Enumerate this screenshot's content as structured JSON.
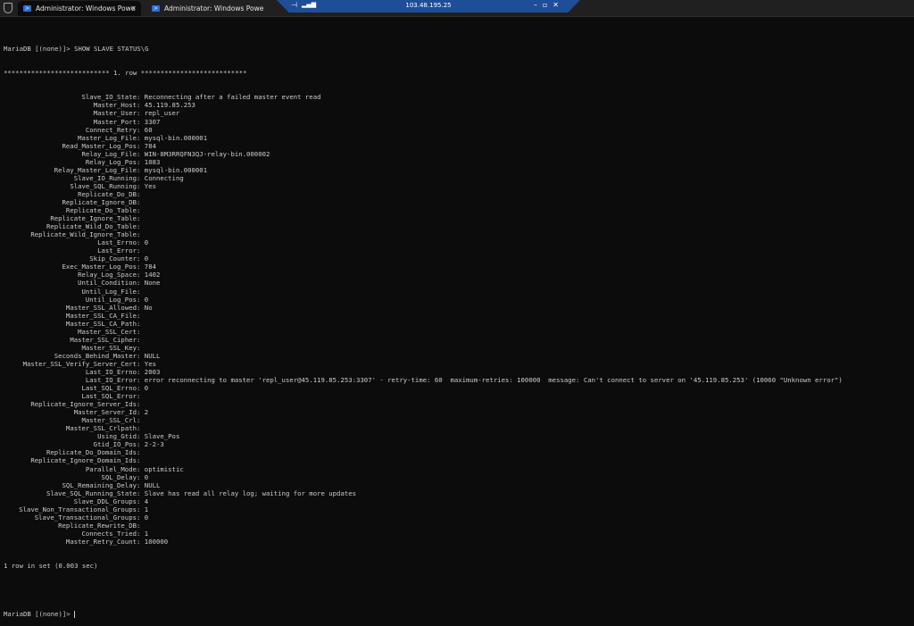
{
  "tabs": [
    {
      "title": "Administrator: Windows Powe",
      "active": true
    },
    {
      "title": "Administrator: Windows Powe",
      "active": false
    }
  ],
  "remote_bar": {
    "ip": "103.48.195.25"
  },
  "console": {
    "command": "MariaDB [(none)]> SHOW SLAVE STATUS\\G",
    "row_header": "*************************** 1. row ***************************",
    "fields": [
      {
        "k": "Slave_IO_State",
        "v": "Reconnecting after a failed master event read"
      },
      {
        "k": "Master_Host",
        "v": "45.119.85.253"
      },
      {
        "k": "Master_User",
        "v": "repl_user"
      },
      {
        "k": "Master_Port",
        "v": "3307"
      },
      {
        "k": "Connect_Retry",
        "v": "60"
      },
      {
        "k": "Master_Log_File",
        "v": "mysql-bin.000001"
      },
      {
        "k": "Read_Master_Log_Pos",
        "v": "784"
      },
      {
        "k": "Relay_Log_File",
        "v": "WIN-8M3RRQFN3QJ-relay-bin.000002"
      },
      {
        "k": "Relay_Log_Pos",
        "v": "1083"
      },
      {
        "k": "Relay_Master_Log_File",
        "v": "mysql-bin.000001"
      },
      {
        "k": "Slave_IO_Running",
        "v": "Connecting"
      },
      {
        "k": "Slave_SQL_Running",
        "v": "Yes"
      },
      {
        "k": "Replicate_Do_DB",
        "v": ""
      },
      {
        "k": "Replicate_Ignore_DB",
        "v": ""
      },
      {
        "k": "Replicate_Do_Table",
        "v": ""
      },
      {
        "k": "Replicate_Ignore_Table",
        "v": ""
      },
      {
        "k": "Replicate_Wild_Do_Table",
        "v": ""
      },
      {
        "k": "Replicate_Wild_Ignore_Table",
        "v": ""
      },
      {
        "k": "Last_Errno",
        "v": "0"
      },
      {
        "k": "Last_Error",
        "v": ""
      },
      {
        "k": "Skip_Counter",
        "v": "0"
      },
      {
        "k": "Exec_Master_Log_Pos",
        "v": "784"
      },
      {
        "k": "Relay_Log_Space",
        "v": "1402"
      },
      {
        "k": "Until_Condition",
        "v": "None"
      },
      {
        "k": "Until_Log_File",
        "v": ""
      },
      {
        "k": "Until_Log_Pos",
        "v": "0"
      },
      {
        "k": "Master_SSL_Allowed",
        "v": "No"
      },
      {
        "k": "Master_SSL_CA_File",
        "v": ""
      },
      {
        "k": "Master_SSL_CA_Path",
        "v": ""
      },
      {
        "k": "Master_SSL_Cert",
        "v": ""
      },
      {
        "k": "Master_SSL_Cipher",
        "v": ""
      },
      {
        "k": "Master_SSL_Key",
        "v": ""
      },
      {
        "k": "Seconds_Behind_Master",
        "v": "NULL"
      },
      {
        "k": "Master_SSL_Verify_Server_Cert",
        "v": "Yes"
      },
      {
        "k": "Last_IO_Errno",
        "v": "2003"
      },
      {
        "k": "Last_IO_Error",
        "v": "error reconnecting to master 'repl_user@45.119.85.253:3307' - retry-time: 60  maximum-retries: 100000  message: Can't connect to server on '45.119.85.253' (10060 \"Unknown error\")"
      },
      {
        "k": "Last_SQL_Errno",
        "v": "0"
      },
      {
        "k": "Last_SQL_Error",
        "v": ""
      },
      {
        "k": "Replicate_Ignore_Server_Ids",
        "v": ""
      },
      {
        "k": "Master_Server_Id",
        "v": "2"
      },
      {
        "k": "Master_SSL_Crl",
        "v": ""
      },
      {
        "k": "Master_SSL_Crlpath",
        "v": ""
      },
      {
        "k": "Using_Gtid",
        "v": "Slave_Pos"
      },
      {
        "k": "Gtid_IO_Pos",
        "v": "2-2-3"
      },
      {
        "k": "Replicate_Do_Domain_Ids",
        "v": ""
      },
      {
        "k": "Replicate_Ignore_Domain_Ids",
        "v": ""
      },
      {
        "k": "Parallel_Mode",
        "v": "optimistic"
      },
      {
        "k": "SQL_Delay",
        "v": "0"
      },
      {
        "k": "SQL_Remaining_Delay",
        "v": "NULL"
      },
      {
        "k": "Slave_SQL_Running_State",
        "v": "Slave has read all relay log; waiting for more updates"
      },
      {
        "k": "Slave_DDL_Groups",
        "v": "4"
      },
      {
        "k": "Slave_Non_Transactional_Groups",
        "v": "1"
      },
      {
        "k": "Slave_Transactional_Groups",
        "v": "0"
      },
      {
        "k": "Replicate_Rewrite_DB",
        "v": ""
      },
      {
        "k": "Connects_Tried",
        "v": "1"
      },
      {
        "k": "Master_Retry_Count",
        "v": "100000"
      }
    ],
    "result": "1 row in set (0.003 sec)",
    "prompt": "MariaDB [(none)]> "
  }
}
